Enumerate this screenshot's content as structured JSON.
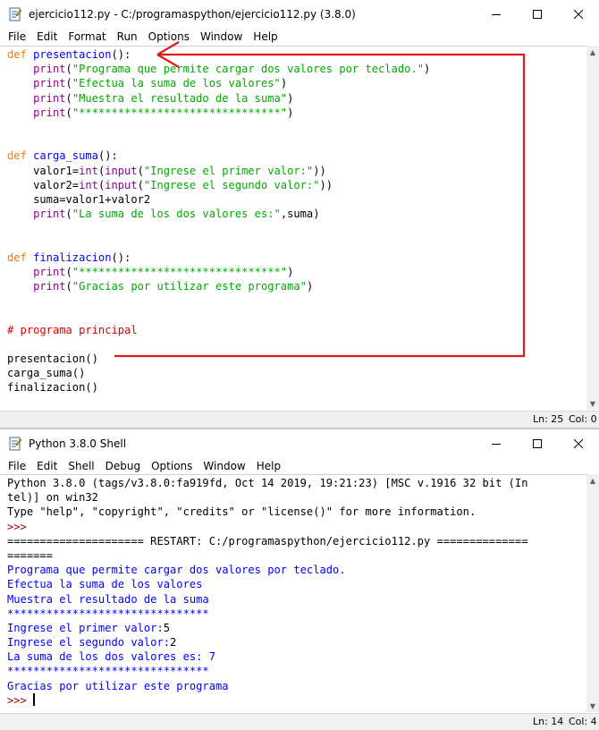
{
  "editor": {
    "title_main": "ejercicio112.py - C:/programaspython/ejercicio112.py (3.8.0)",
    "menus": [
      "File",
      "Edit",
      "Format",
      "Run",
      "Options",
      "Window",
      "Help"
    ],
    "status_ln": "Ln: 25",
    "status_col": "Col: 0",
    "code_lines": [
      [
        [
          "kw",
          "def"
        ],
        [
          "t",
          " "
        ],
        [
          "def",
          "presentacion"
        ],
        [
          "t",
          "():"
        ]
      ],
      [
        [
          "t",
          "    "
        ],
        [
          "bi",
          "print"
        ],
        [
          "t",
          "("
        ],
        [
          "str",
          "\"Programa que permite cargar dos valores por teclado.\""
        ],
        [
          "t",
          ")"
        ]
      ],
      [
        [
          "t",
          "    "
        ],
        [
          "bi",
          "print"
        ],
        [
          "t",
          "("
        ],
        [
          "str",
          "\"Efectua la suma de los valores\""
        ],
        [
          "t",
          ")"
        ]
      ],
      [
        [
          "t",
          "    "
        ],
        [
          "bi",
          "print"
        ],
        [
          "t",
          "("
        ],
        [
          "str",
          "\"Muestra el resultado de la suma\""
        ],
        [
          "t",
          ")"
        ]
      ],
      [
        [
          "t",
          "    "
        ],
        [
          "bi",
          "print"
        ],
        [
          "t",
          "("
        ],
        [
          "str",
          "\"*******************************\""
        ],
        [
          "t",
          ")"
        ]
      ],
      [],
      [],
      [
        [
          "kw",
          "def"
        ],
        [
          "t",
          " "
        ],
        [
          "def",
          "carga_suma"
        ],
        [
          "t",
          "():"
        ]
      ],
      [
        [
          "t",
          "    valor1="
        ],
        [
          "bi",
          "int"
        ],
        [
          "t",
          "("
        ],
        [
          "bi",
          "input"
        ],
        [
          "t",
          "("
        ],
        [
          "str",
          "\"Ingrese el primer valor:\""
        ],
        [
          "t",
          "))"
        ]
      ],
      [
        [
          "t",
          "    valor2="
        ],
        [
          "bi",
          "int"
        ],
        [
          "t",
          "("
        ],
        [
          "bi",
          "input"
        ],
        [
          "t",
          "("
        ],
        [
          "str",
          "\"Ingrese el segundo valor:\""
        ],
        [
          "t",
          "))"
        ]
      ],
      [
        [
          "t",
          "    suma=valor1+valor2"
        ]
      ],
      [
        [
          "t",
          "    "
        ],
        [
          "bi",
          "print"
        ],
        [
          "t",
          "("
        ],
        [
          "str",
          "\"La suma de los dos valores es:\""
        ],
        [
          "t",
          ",suma)"
        ]
      ],
      [],
      [],
      [
        [
          "kw",
          "def"
        ],
        [
          "t",
          " "
        ],
        [
          "def",
          "finalizacion"
        ],
        [
          "t",
          "():"
        ]
      ],
      [
        [
          "t",
          "    "
        ],
        [
          "bi",
          "print"
        ],
        [
          "t",
          "("
        ],
        [
          "str",
          "\"*******************************\""
        ],
        [
          "t",
          ")"
        ]
      ],
      [
        [
          "t",
          "    "
        ],
        [
          "bi",
          "print"
        ],
        [
          "t",
          "("
        ],
        [
          "str",
          "\"Gracias por utilizar este programa\""
        ],
        [
          "t",
          ")"
        ]
      ],
      [],
      [],
      [
        [
          "cmt",
          "# programa principal"
        ]
      ],
      [],
      [
        [
          "t",
          "presentacion()"
        ]
      ],
      [
        [
          "t",
          "carga_suma()"
        ]
      ],
      [
        [
          "t",
          "finalizacion()"
        ]
      ]
    ]
  },
  "shell": {
    "title": "Python 3.8.0 Shell",
    "menus": [
      "File",
      "Edit",
      "Shell",
      "Debug",
      "Options",
      "Window",
      "Help"
    ],
    "status_ln": "Ln: 14",
    "status_col": "Col: 4",
    "lines": [
      [
        [
          "t",
          "Python 3.8.0 (tags/v3.8.0:fa919fd, Oct 14 2019, 19:21:23) [MSC v.1916 32 bit (In"
        ]
      ],
      [
        [
          "t",
          "tel)] on win32"
        ]
      ],
      [
        [
          "t",
          "Type \"help\", \"copyright\", \"credits\" or \"license()\" for more information."
        ]
      ],
      [
        [
          "prompt",
          ">>> "
        ]
      ],
      [
        [
          "t",
          "===================== RESTART: C:/programaspython/ejercicio112.py =============="
        ]
      ],
      [
        [
          "t",
          "======="
        ]
      ],
      [
        [
          "out",
          "Programa que permite cargar dos valores por teclado."
        ]
      ],
      [
        [
          "out",
          "Efectua la suma de los valores"
        ]
      ],
      [
        [
          "out",
          "Muestra el resultado de la suma"
        ]
      ],
      [
        [
          "out",
          "*******************************"
        ]
      ],
      [
        [
          "out",
          "Ingrese el primer valor:"
        ],
        [
          "t",
          "5"
        ]
      ],
      [
        [
          "out",
          "Ingrese el segundo valor:"
        ],
        [
          "t",
          "2"
        ]
      ],
      [
        [
          "out",
          "La suma de los dos valores es: 7"
        ]
      ],
      [
        [
          "out",
          "*******************************"
        ]
      ],
      [
        [
          "out",
          "Gracias por utilizar este programa"
        ]
      ],
      [
        [
          "prompt",
          ">>> "
        ]
      ]
    ]
  },
  "annotation_color": "#dd1c1c"
}
